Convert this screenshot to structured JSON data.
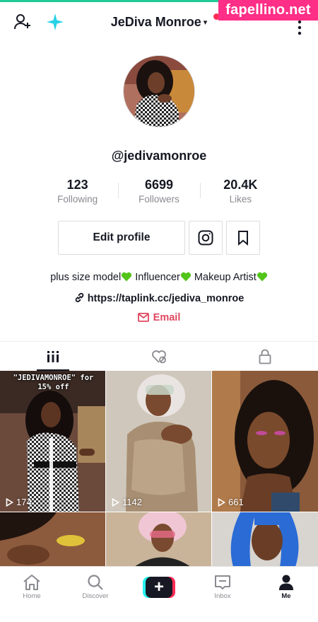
{
  "colors": {
    "accent": "#fe2c55",
    "email": "#e0475f",
    "watermark": "#ff2e86",
    "heart": "#52c41a"
  },
  "header": {
    "title": "JeDiva Monroe",
    "caret": "▾",
    "add_user_icon": "add-user-icon",
    "sparkle_icon": "sparkle-icon",
    "more_icon": "more-vertical-icon"
  },
  "watermark": "fapellino.net",
  "profile": {
    "username": "@jediva​monroe",
    "stats": [
      {
        "value": "123",
        "label": "Following"
      },
      {
        "value": "6699",
        "label": "Followers"
      },
      {
        "value": "20.4K",
        "label": "Likes"
      }
    ],
    "edit_label": "Edit profile",
    "bio": [
      "plus size model",
      "Influencer",
      "Makeup Artist"
    ],
    "link": "https://taplink.cc/jediva_monroe",
    "email_label": "Email"
  },
  "tabs": [
    {
      "name": "videos",
      "icon": "grid-icon",
      "active": true
    },
    {
      "name": "liked",
      "icon": "liked-hidden-icon",
      "active": false
    },
    {
      "name": "private",
      "icon": "lock-icon",
      "active": false
    }
  ],
  "videos": [
    {
      "views": "174",
      "caption": "\"JEDIVAMONROE\" for 15% off"
    },
    {
      "views": "1142",
      "caption": ""
    },
    {
      "views": "661",
      "caption": ""
    },
    {
      "views": "",
      "caption": ""
    },
    {
      "views": "",
      "caption": ""
    },
    {
      "views": "",
      "caption": ""
    }
  ],
  "nav": [
    {
      "label": "Home",
      "icon": "home-icon"
    },
    {
      "label": "Discover",
      "icon": "search-icon"
    },
    {
      "label": "",
      "icon": "create-plus-icon"
    },
    {
      "label": "Inbox",
      "icon": "inbox-icon"
    },
    {
      "label": "Me",
      "icon": "profile-icon"
    }
  ]
}
